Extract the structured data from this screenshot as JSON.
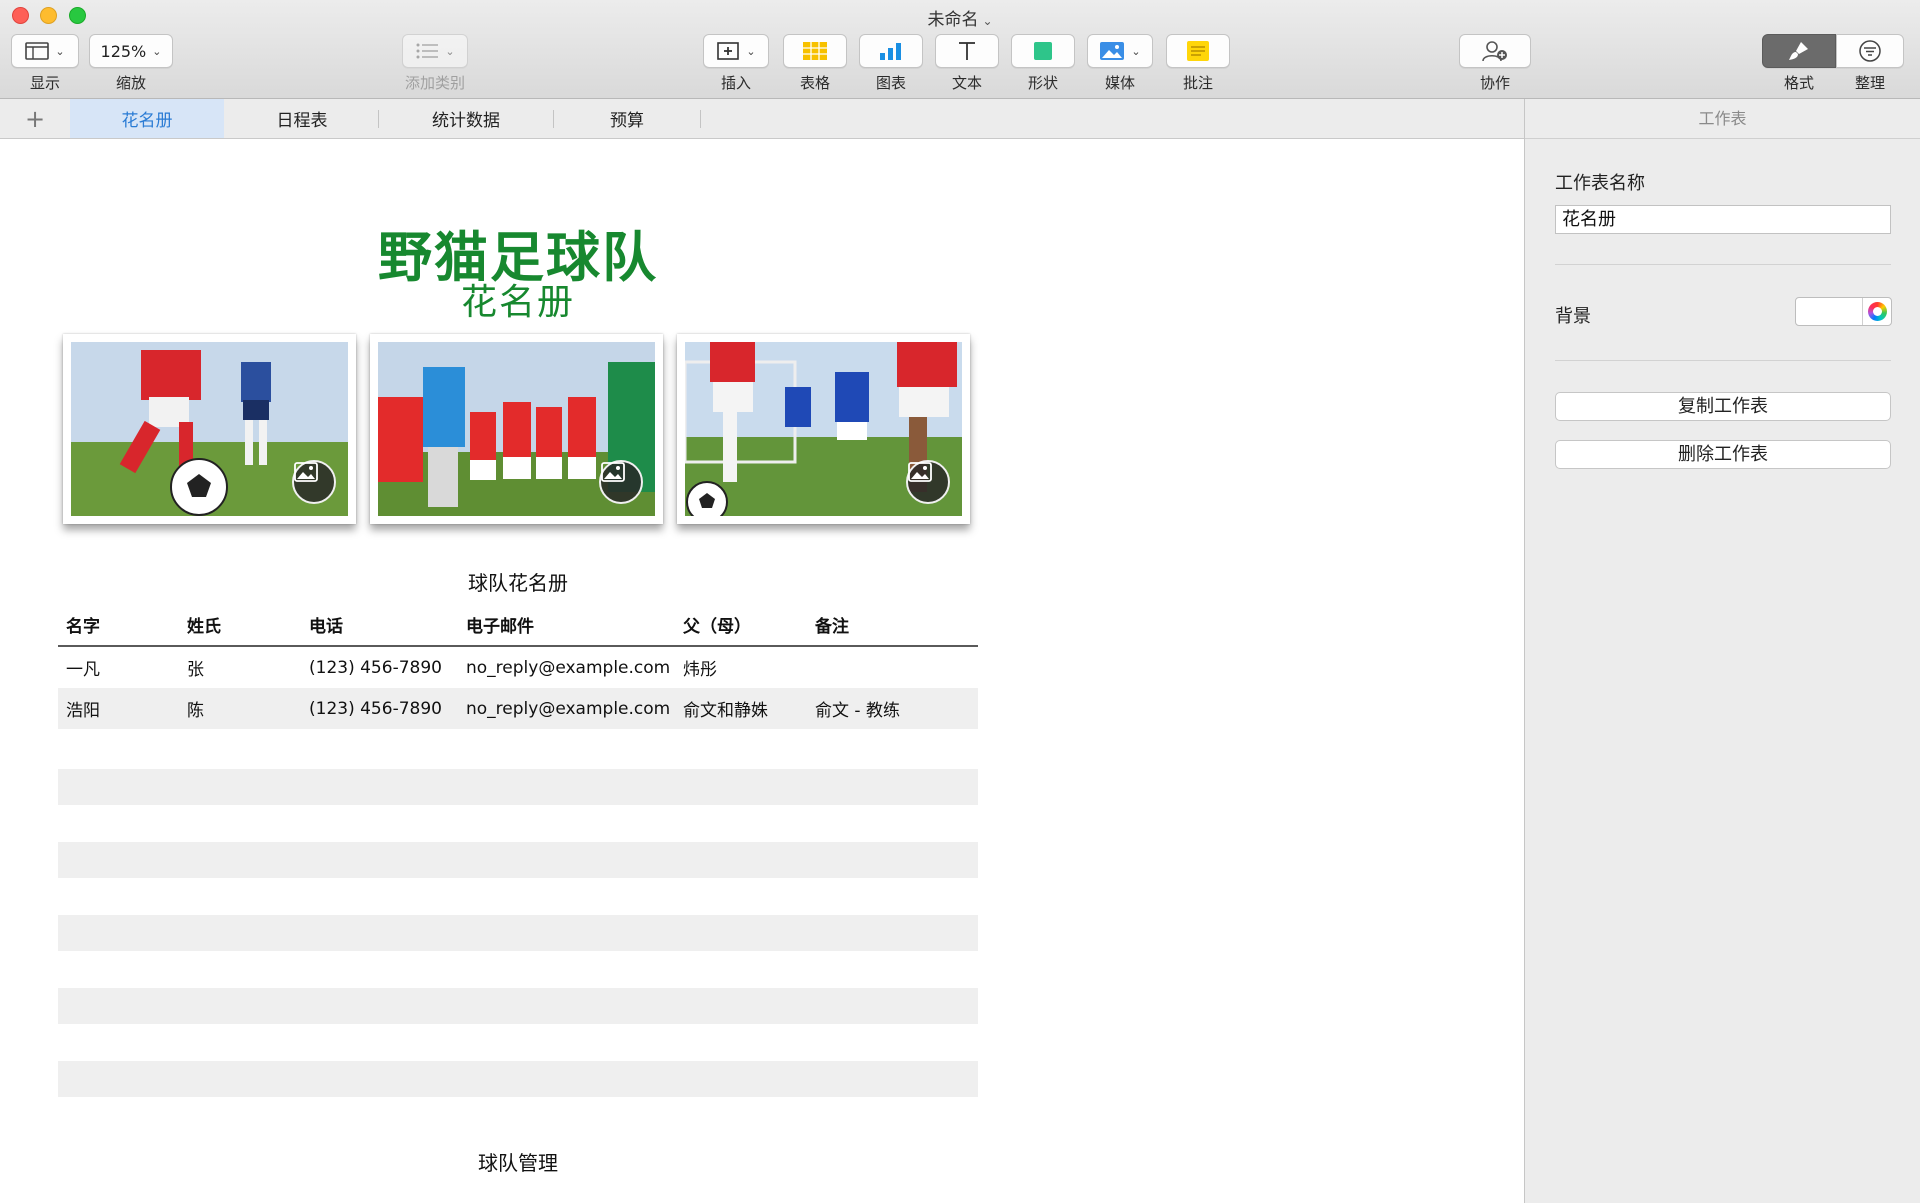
{
  "window": {
    "title": "未命名"
  },
  "toolbar": {
    "view": {
      "label": "显示",
      "icon": "sidebar-view-icon"
    },
    "zoom": {
      "label": "缩放",
      "value": "125%"
    },
    "category": {
      "label": "添加类别",
      "icon": "list-icon"
    },
    "insert": {
      "label": "插入",
      "icon": "insert-plus-icon"
    },
    "table": {
      "label": "表格",
      "icon": "table-icon"
    },
    "chart": {
      "label": "图表",
      "icon": "bar-chart-icon"
    },
    "text": {
      "label": "文本",
      "icon": "text-t-icon"
    },
    "shape": {
      "label": "形状",
      "icon": "shape-square-icon"
    },
    "media": {
      "label": "媒体",
      "icon": "photo-icon"
    },
    "comment": {
      "label": "批注",
      "icon": "note-icon"
    },
    "collaborate": {
      "label": "协作",
      "icon": "person-add-icon"
    },
    "format": {
      "label": "格式",
      "icon": "paintbrush-icon"
    },
    "organize": {
      "label": "整理",
      "icon": "filter-lines-icon"
    }
  },
  "tabs": [
    {
      "label": "花名册",
      "active": true
    },
    {
      "label": "日程表",
      "active": false
    },
    {
      "label": "统计数据",
      "active": false
    },
    {
      "label": "预算",
      "active": false
    }
  ],
  "sidebar": {
    "header": "工作表",
    "sheet_name_label": "工作表名称",
    "sheet_name_value": "花名册",
    "background_label": "背景",
    "duplicate_button": "复制工作表",
    "delete_button": "删除工作表"
  },
  "canvas": {
    "title": "野猫足球队",
    "subtitle": "花名册",
    "roster_table": {
      "title": "球队花名册",
      "columns": [
        "名字",
        "姓氏",
        "电话",
        "电子邮件",
        "父（母）",
        "备注"
      ],
      "rows": [
        [
          "一凡",
          "张",
          "(123) 456-7890",
          "no_reply@example.com",
          "炜彤",
          ""
        ],
        [
          "浩阳",
          "陈",
          "(123) 456-7890",
          "no_reply@example.com",
          "俞文和静姝",
          "俞文 - 教练"
        ]
      ]
    },
    "management_table": {
      "title": "球队管理"
    }
  },
  "colors": {
    "title_green": "#17882f",
    "tab_active_text": "#2a7bd4",
    "tab_active_bg": "#d7e5f7",
    "row_alt": "#efefef"
  }
}
